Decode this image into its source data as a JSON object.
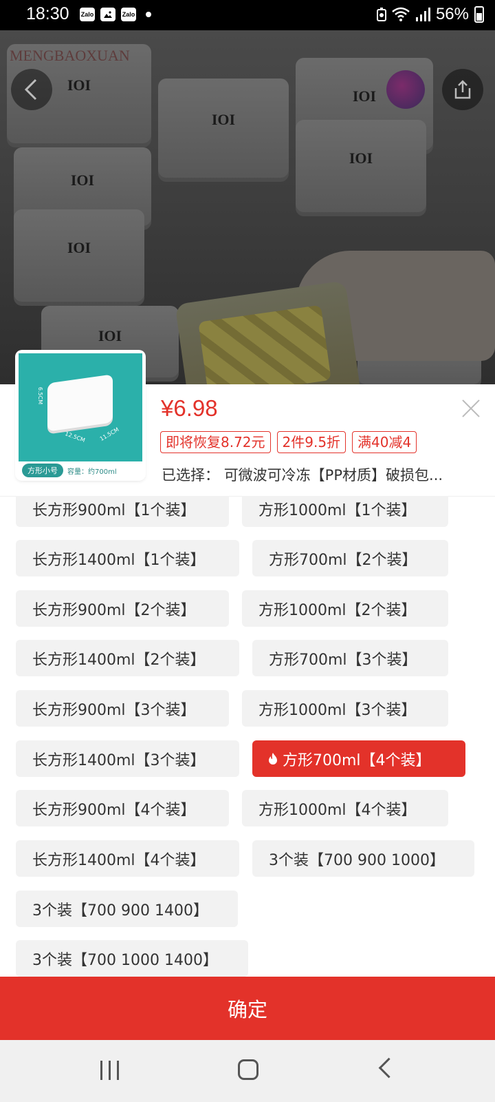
{
  "status_bar": {
    "time": "18:30",
    "notif_apps": [
      "Zalo",
      "Zalo"
    ],
    "battery": "56%"
  },
  "hero": {
    "watermark": "MENGBAOXUAN",
    "logo_text": "IOI"
  },
  "product": {
    "price": "¥6.98",
    "promos": [
      "即将恢复8.72元",
      "2件9.5折",
      "满40减4"
    ],
    "selected_label": "已选择：",
    "selected_value": "可微波可冷冻【PP材质】破损包...",
    "thumb_tag": "方形小号",
    "thumb_capacity": "容量：约700ml",
    "thumb_dims": [
      "12.5CM",
      "11.5CM",
      "6.5CM"
    ]
  },
  "options": [
    {
      "label": "长方形900ml【1个装】"
    },
    {
      "label": "方形1000ml【1个装】"
    },
    {
      "label": "长方形1400ml【1个装】"
    },
    {
      "label": "方形700ml【2个装】"
    },
    {
      "label": "长方形900ml【2个装】"
    },
    {
      "label": "方形1000ml【2个装】"
    },
    {
      "label": "长方形1400ml【2个装】"
    },
    {
      "label": "方形700ml【3个装】"
    },
    {
      "label": "长方形900ml【3个装】"
    },
    {
      "label": "方形1000ml【3个装】"
    },
    {
      "label": "长方形1400ml【3个装】"
    },
    {
      "label": "方形700ml【4个装】",
      "selected": true
    },
    {
      "label": "长方形900ml【4个装】"
    },
    {
      "label": "方形1000ml【4个装】"
    },
    {
      "label": "长方形1400ml【4个装】"
    },
    {
      "label": "3个装【700 900 1000】"
    },
    {
      "label": "3个装【700 900 1400】"
    },
    {
      "label": "3个装【700 1000 1400】"
    }
  ],
  "confirm_label": "确定",
  "colors": {
    "accent": "#e3322a",
    "chip_bg": "#f2f2f2",
    "teal": "#2bb0aa"
  }
}
